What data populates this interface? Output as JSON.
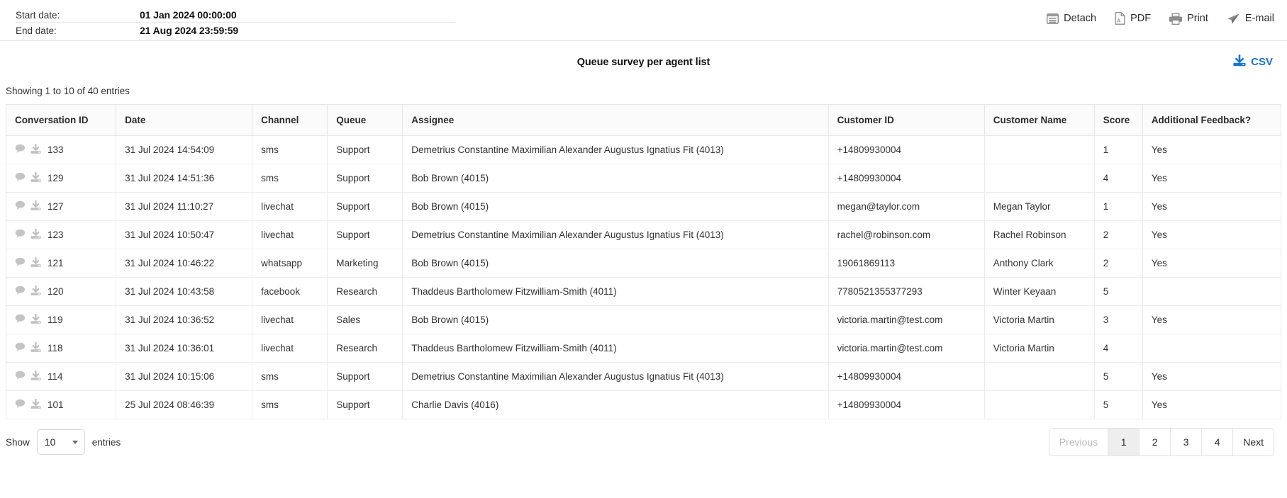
{
  "header": {
    "start_date_label": "Start date:",
    "start_date_value": "01 Jan 2024 00:00:00",
    "end_date_label": "End date:",
    "end_date_value": "21 Aug 2024 23:59:59",
    "toolbar": [
      {
        "label": "Detach",
        "icon": "list-detach-icon"
      },
      {
        "label": "PDF",
        "icon": "pdf-file-icon"
      },
      {
        "label": "Print",
        "icon": "printer-icon"
      },
      {
        "label": "E-mail",
        "icon": "paper-plane-icon"
      }
    ]
  },
  "report": {
    "title": "Queue survey per agent list",
    "csv_label": "CSV",
    "csv_icon": "download-icon",
    "csv_color": "#1675d1",
    "entries_info": "Showing 1 to 10 of 40 entries"
  },
  "table": {
    "columns": [
      "Conversation ID",
      "Date",
      "Channel",
      "Queue",
      "Assignee",
      "Customer ID",
      "Customer Name",
      "Score",
      "Additional Feedback?"
    ],
    "row_icons": [
      "chat-bubble-icon",
      "download-icon"
    ],
    "rows": [
      {
        "conversation_id": "133",
        "date": "31 Jul 2024 14:54:09",
        "channel": "sms",
        "queue": "Support",
        "assignee": "Demetrius Constantine Maximilian Alexander Augustus Ignatius Fit (4013)",
        "customer_id": "+14809930004",
        "customer_name": "",
        "score": "1",
        "additional_feedback": "Yes"
      },
      {
        "conversation_id": "129",
        "date": "31 Jul 2024 14:51:36",
        "channel": "sms",
        "queue": "Support",
        "assignee": "Bob Brown (4015)",
        "customer_id": "+14809930004",
        "customer_name": "",
        "score": "4",
        "additional_feedback": "Yes"
      },
      {
        "conversation_id": "127",
        "date": "31 Jul 2024 11:10:27",
        "channel": "livechat",
        "queue": "Support",
        "assignee": "Bob Brown (4015)",
        "customer_id": "megan@taylor.com",
        "customer_name": "Megan Taylor",
        "score": "1",
        "additional_feedback": "Yes"
      },
      {
        "conversation_id": "123",
        "date": "31 Jul 2024 10:50:47",
        "channel": "livechat",
        "queue": "Support",
        "assignee": "Demetrius Constantine Maximilian Alexander Augustus Ignatius Fit (4013)",
        "customer_id": "rachel@robinson.com",
        "customer_name": "Rachel Robinson",
        "score": "2",
        "additional_feedback": "Yes"
      },
      {
        "conversation_id": "121",
        "date": "31 Jul 2024 10:46:22",
        "channel": "whatsapp",
        "queue": "Marketing",
        "assignee": "Bob Brown (4015)",
        "customer_id": "19061869113",
        "customer_name": "Anthony Clark",
        "score": "2",
        "additional_feedback": "Yes"
      },
      {
        "conversation_id": "120",
        "date": "31 Jul 2024 10:43:58",
        "channel": "facebook",
        "queue": "Research",
        "assignee": "Thaddeus Bartholomew Fitzwilliam-Smith (4011)",
        "customer_id": "7780521355377293",
        "customer_name": "Winter Keyaan",
        "score": "5",
        "additional_feedback": ""
      },
      {
        "conversation_id": "119",
        "date": "31 Jul 2024 10:36:52",
        "channel": "livechat",
        "queue": "Sales",
        "assignee": "Bob Brown (4015)",
        "customer_id": "victoria.martin@test.com",
        "customer_name": "Victoria Martin",
        "score": "3",
        "additional_feedback": "Yes"
      },
      {
        "conversation_id": "118",
        "date": "31 Jul 2024 10:36:01",
        "channel": "livechat",
        "queue": "Research",
        "assignee": "Thaddeus Bartholomew Fitzwilliam-Smith (4011)",
        "customer_id": "victoria.martin@test.com",
        "customer_name": "Victoria Martin",
        "score": "4",
        "additional_feedback": ""
      },
      {
        "conversation_id": "114",
        "date": "31 Jul 2024 10:15:06",
        "channel": "sms",
        "queue": "Support",
        "assignee": "Demetrius Constantine Maximilian Alexander Augustus Ignatius Fit (4013)",
        "customer_id": "+14809930004",
        "customer_name": "",
        "score": "5",
        "additional_feedback": "Yes"
      },
      {
        "conversation_id": "101",
        "date": "25 Jul 2024 08:46:39",
        "channel": "sms",
        "queue": "Support",
        "assignee": "Charlie Davis (4016)",
        "customer_id": "+14809930004",
        "customer_name": "",
        "score": "5",
        "additional_feedback": "Yes"
      }
    ]
  },
  "footer": {
    "show_label": "Show",
    "entries_label": "entries",
    "page_size_value": "10",
    "pagination": [
      {
        "label": "Previous",
        "state": "disabled"
      },
      {
        "label": "1",
        "state": "active"
      },
      {
        "label": "2",
        "state": "normal"
      },
      {
        "label": "3",
        "state": "normal"
      },
      {
        "label": "4",
        "state": "normal"
      },
      {
        "label": "Next",
        "state": "normal"
      }
    ]
  }
}
